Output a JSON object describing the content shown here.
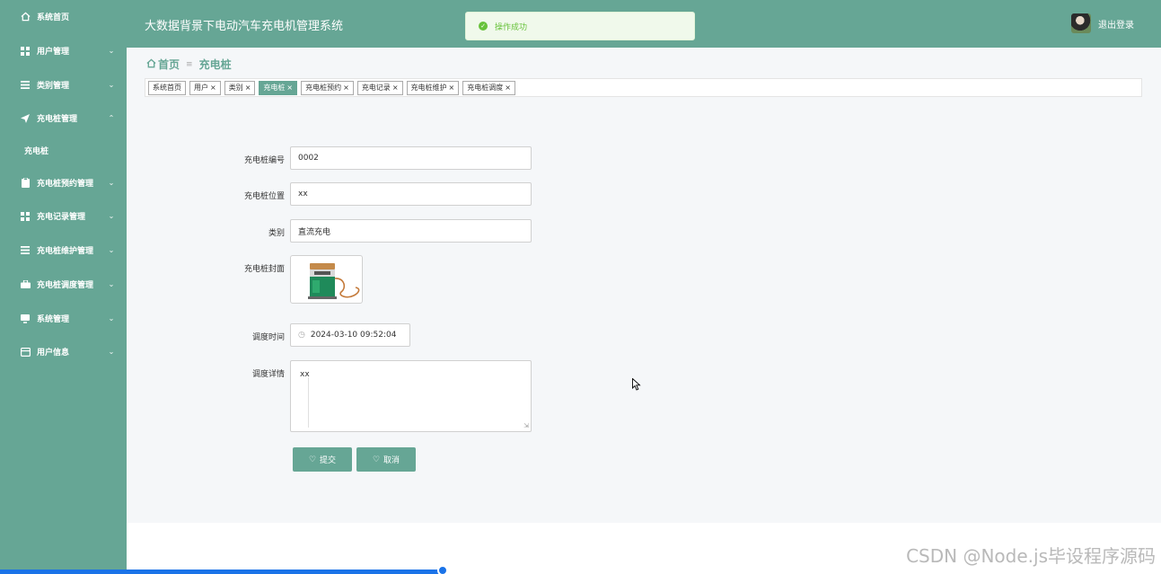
{
  "header": {
    "title": "大数据背景下电动汽车充电机管理系统",
    "toast": "操作成功",
    "logout_label": "退出登录"
  },
  "sidebar": {
    "items": [
      {
        "label": "系统首页",
        "icon": "home-icon"
      },
      {
        "label": "用户管理",
        "icon": "grid-icon"
      },
      {
        "label": "类别管理",
        "icon": "list-icon"
      },
      {
        "label": "充电桩管理",
        "icon": "send-icon"
      },
      {
        "label": "充电桩预约管理",
        "icon": "clipboard-icon"
      },
      {
        "label": "充电记录管理",
        "icon": "grid-icon"
      },
      {
        "label": "充电桩维护管理",
        "icon": "list-icon"
      },
      {
        "label": "充电桩调度管理",
        "icon": "briefcase-icon"
      },
      {
        "label": "系统管理",
        "icon": "monitor-icon"
      },
      {
        "label": "用户信息",
        "icon": "card-icon"
      }
    ],
    "sub_item": "充电桩"
  },
  "breadcrumb": {
    "home": "首页",
    "current": "充电桩"
  },
  "tabs": [
    {
      "label": "系统首页"
    },
    {
      "label": "用户"
    },
    {
      "label": "类别"
    },
    {
      "label": "充电桩"
    },
    {
      "label": "充电桩预约"
    },
    {
      "label": "充电记录"
    },
    {
      "label": "充电桩维护"
    },
    {
      "label": "充电桩调度"
    }
  ],
  "form": {
    "code_label": "充电桩编号",
    "code_value": "0002",
    "location_label": "充电桩位置",
    "location_value": "xx",
    "category_label": "类别",
    "category_value": "直流充电",
    "cover_label": "充电桩封面",
    "time_label": "调度时间",
    "time_value": "2024-03-10 09:52:04",
    "detail_label": "调度详情",
    "detail_value": "xx",
    "submit_label": "提交",
    "cancel_label": "取消"
  },
  "watermark": "CSDN @Node.js毕设程序源码",
  "colors": {
    "primary": "#66a695",
    "content_bg": "#f5f7f9",
    "success": "#67c23a"
  }
}
